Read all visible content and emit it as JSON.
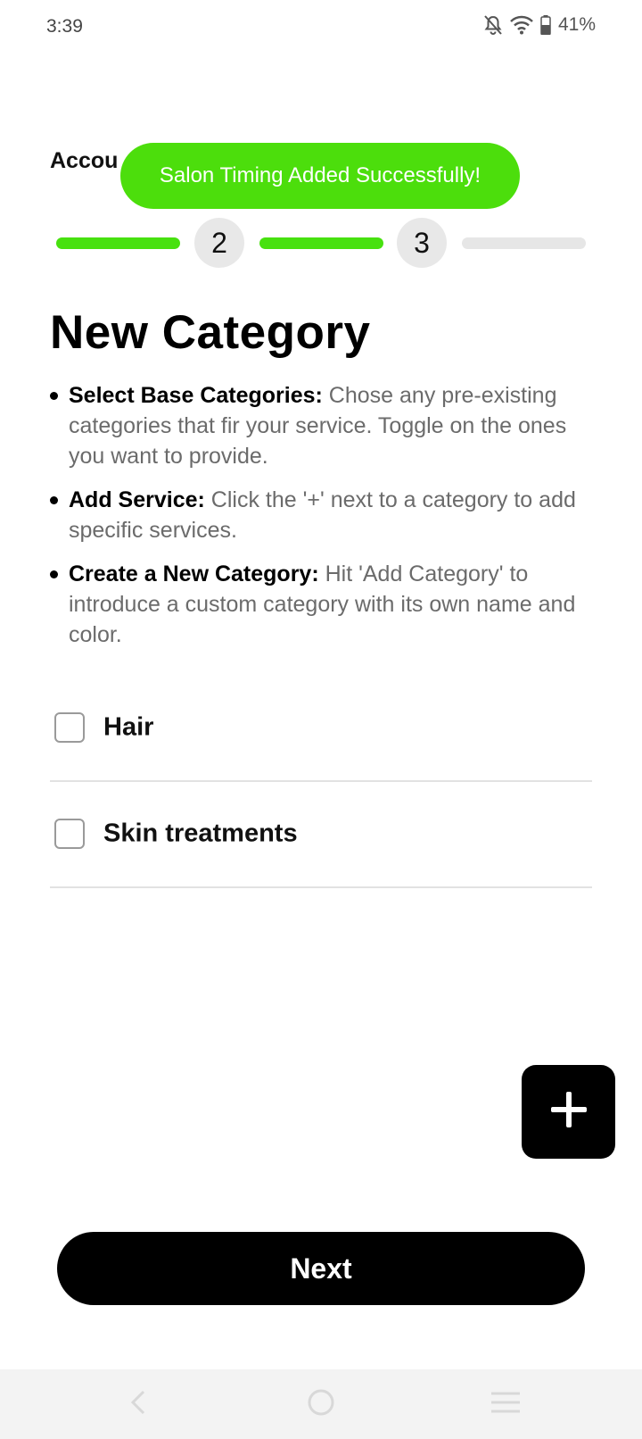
{
  "status_bar": {
    "time": "3:39",
    "battery": "41%",
    "icons": [
      "bell-off-icon",
      "wifi-icon",
      "battery-icon"
    ]
  },
  "header": {
    "title": "Accou"
  },
  "toast": {
    "text": "Salon Timing Added Successfully!",
    "color": "#4cde0c"
  },
  "stepper": {
    "steps": [
      "2",
      "3"
    ],
    "accent": "#47e10f"
  },
  "page": {
    "title": "New Category"
  },
  "instructions": [
    {
      "bold": "Select Base Categories:",
      "text": " Chose any pre-existing categories that fir your service. Toggle on the ones you want to provide."
    },
    {
      "bold": "Add Service:",
      "text": " Click the '+' next to a category to add specific services."
    },
    {
      "bold": "Create a New Category:",
      "text": " Hit 'Add Category' to introduce a custom category with its own name and color."
    }
  ],
  "categories": [
    {
      "label": "Hair",
      "checked": false
    },
    {
      "label": "Skin treatments",
      "checked": false
    }
  ],
  "fab": {
    "icon": "plus-icon"
  },
  "footer": {
    "next_label": "Next"
  },
  "nav_bar": {
    "icons": [
      "back-icon",
      "home-icon",
      "recents-icon"
    ]
  }
}
